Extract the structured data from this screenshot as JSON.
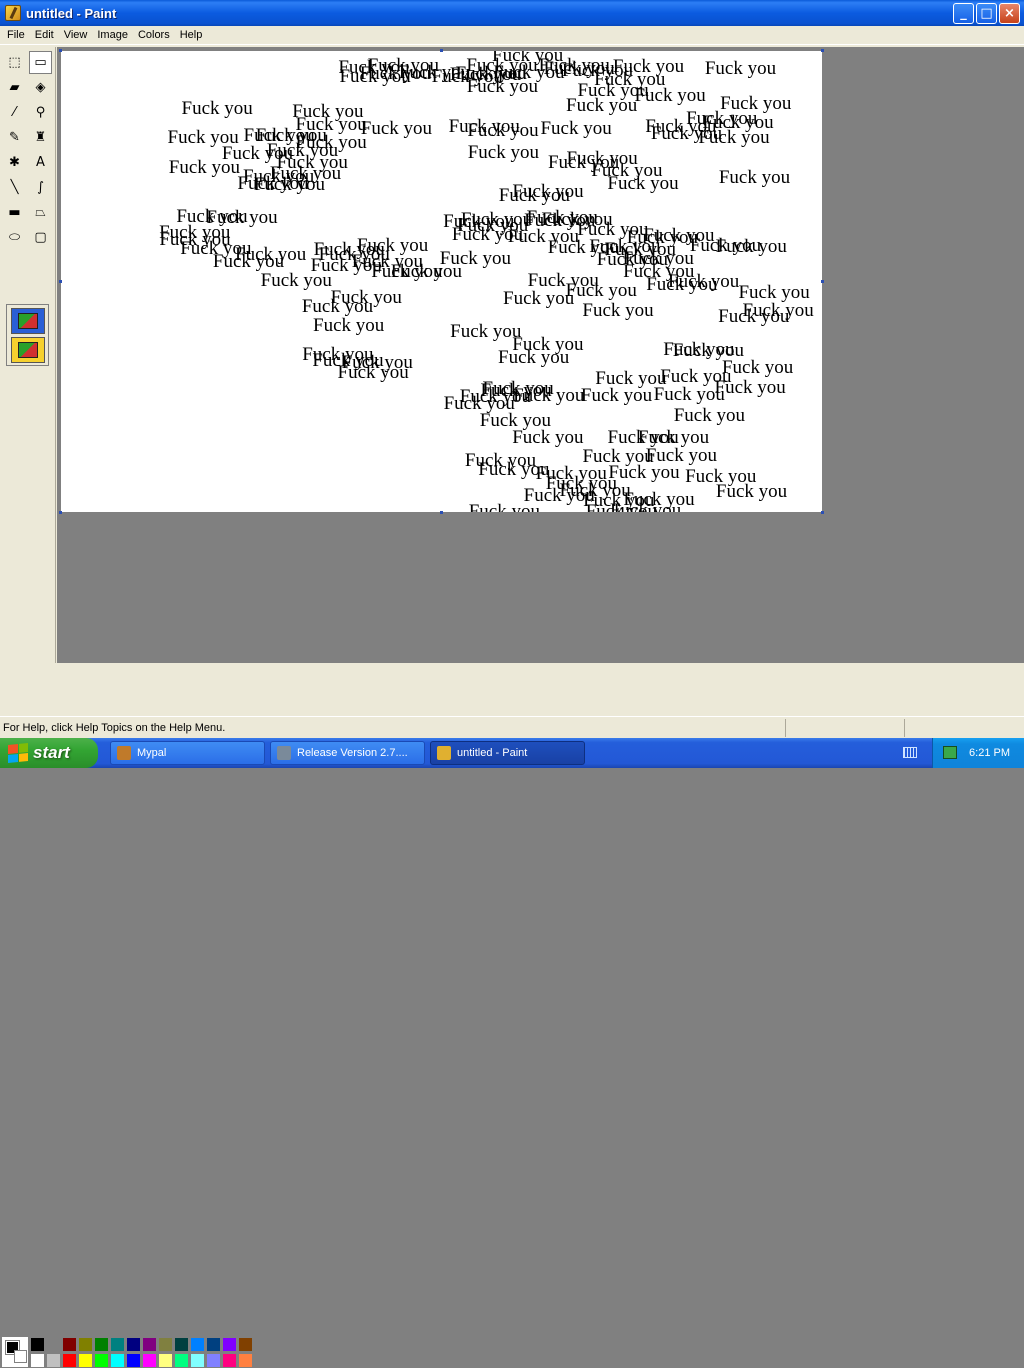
{
  "window": {
    "title": "untitled - Paint"
  },
  "title_buttons": {
    "minimize": "_",
    "maximize": "□",
    "close": "×"
  },
  "menu": [
    "File",
    "Edit",
    "View",
    "Image",
    "Colors",
    "Help"
  ],
  "tools": [
    {
      "name": "free-select-tool",
      "glyph": "⬚"
    },
    {
      "name": "rect-select-tool",
      "glyph": "▭"
    },
    {
      "name": "eraser-tool",
      "glyph": "▰"
    },
    {
      "name": "fill-tool",
      "glyph": "◈"
    },
    {
      "name": "color-picker-tool",
      "glyph": "⁄"
    },
    {
      "name": "magnifier-tool",
      "glyph": "⚲"
    },
    {
      "name": "pencil-tool",
      "glyph": "✎"
    },
    {
      "name": "brush-tool",
      "glyph": "♜"
    },
    {
      "name": "airbrush-tool",
      "glyph": "✱"
    },
    {
      "name": "text-tool",
      "glyph": "A"
    },
    {
      "name": "line-tool",
      "glyph": "╲"
    },
    {
      "name": "curve-tool",
      "glyph": "∫"
    },
    {
      "name": "rectangle-tool",
      "glyph": "▬"
    },
    {
      "name": "polygon-tool",
      "glyph": "⏢"
    },
    {
      "name": "ellipse-tool",
      "glyph": "⬭"
    },
    {
      "name": "rounded-rect-tool",
      "glyph": "▢"
    }
  ],
  "canvas": {
    "stamp_text": "Fuck you"
  },
  "palette": {
    "foreground": "#000000",
    "background": "#ffffff",
    "top": [
      "#000000",
      "#808080",
      "#800000",
      "#808000",
      "#008000",
      "#008080",
      "#000080",
      "#800080",
      "#808040",
      "#004040",
      "#0080ff",
      "#004080",
      "#8000ff",
      "#804000"
    ],
    "bottom": [
      "#ffffff",
      "#c0c0c0",
      "#ff0000",
      "#ffff00",
      "#00ff00",
      "#00ffff",
      "#0000ff",
      "#ff00ff",
      "#ffff80",
      "#00ff80",
      "#80ffff",
      "#8080ff",
      "#ff0080",
      "#ff8040"
    ]
  },
  "status": {
    "help_text": "For Help, click Help Topics on the Help Menu."
  },
  "taskbar": {
    "start_label": "start",
    "tasks": [
      {
        "label": "Mypal",
        "icon_color": "#c07a2a",
        "active": false
      },
      {
        "label": "Release Version 2.7....",
        "icon_color": "#7a8a9a",
        "active": false
      },
      {
        "label": "untitled - Paint",
        "icon_color": "#e0b030",
        "active": true
      }
    ],
    "clock": "6:21 PM"
  }
}
